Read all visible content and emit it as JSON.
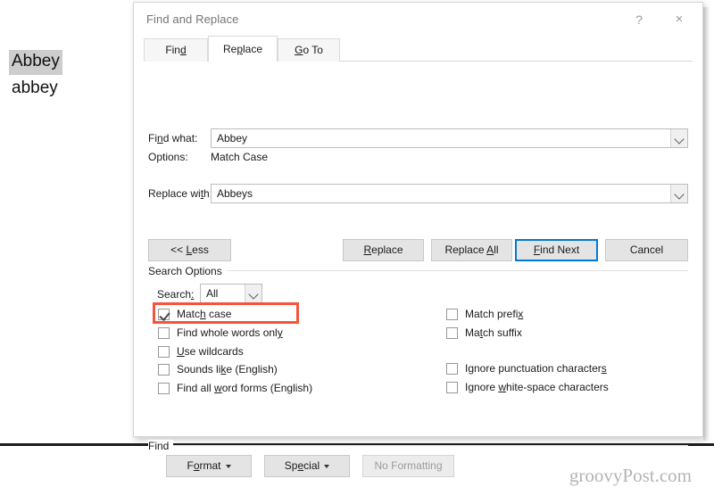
{
  "document": {
    "selected_word": "Abbey",
    "plain_word": "abbey"
  },
  "dialog": {
    "title": "Find and Replace",
    "help_icon": "?",
    "close_icon": "×",
    "tabs": [
      {
        "label": "Find",
        "accel": "d",
        "active": false
      },
      {
        "label": "Replace",
        "accel": "p",
        "active": true
      },
      {
        "label": "Go To",
        "accel": "G",
        "active": false
      }
    ],
    "find_what": {
      "label": "Find what:",
      "value": "Abbey"
    },
    "options": {
      "label": "Options:",
      "value": "Match Case"
    },
    "replace_with": {
      "label": "Replace with:",
      "value": "Abbeys"
    },
    "buttons": {
      "less": "<< Less",
      "replace": "Replace",
      "replace_all": "Replace All",
      "find_next": "Find Next",
      "cancel": "Cancel"
    },
    "search_options": {
      "group_label": "Search Options",
      "search_label": "Search:",
      "search_value": "All",
      "left_checkboxes": [
        {
          "label": "Match case",
          "checked": true
        },
        {
          "label": "Find whole words only",
          "checked": false
        },
        {
          "label": "Use wildcards",
          "checked": false
        },
        {
          "label": "Sounds like (English)",
          "checked": false
        },
        {
          "label": "Find all word forms (English)",
          "checked": false
        }
      ],
      "right_checkboxes": [
        {
          "label": "Match prefix",
          "checked": false
        },
        {
          "label": "Match suffix",
          "checked": false
        },
        {
          "label": "Ignore punctuation characters",
          "checked": false
        },
        {
          "label": "Ignore white-space characters",
          "checked": false
        }
      ]
    },
    "find_group": {
      "group_label": "Find",
      "format": "Format",
      "special": "Special",
      "no_formatting": "No Formatting"
    }
  },
  "watermark": "groovyPost.com",
  "colors": {
    "focus_blue": "#0078d7",
    "annotation_red": "#f4543c",
    "selection_gray": "#cdcdcd"
  }
}
